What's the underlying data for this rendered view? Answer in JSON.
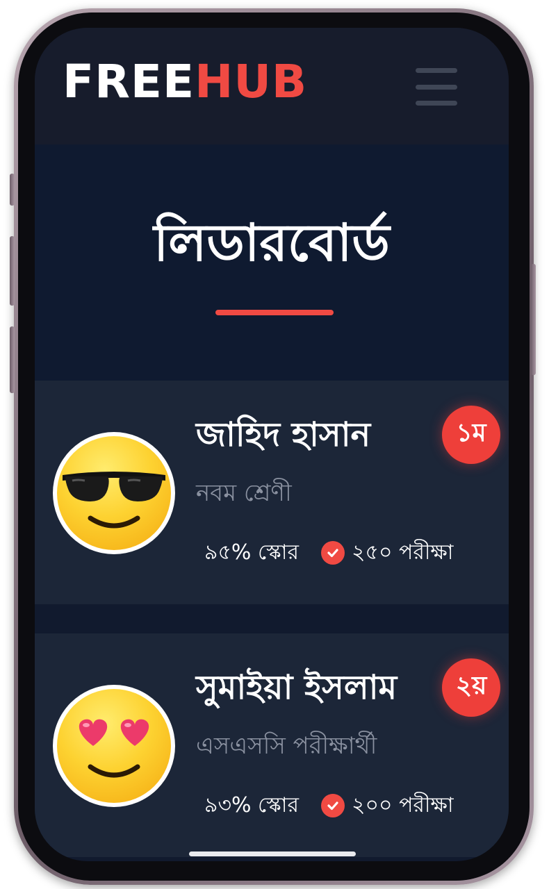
{
  "header": {
    "logo_part1": "FREE",
    "logo_part2": "HUB",
    "menu_icon": "hamburger-menu-icon"
  },
  "page": {
    "title": "লিডারবোর্ড"
  },
  "leaderboard": [
    {
      "name": "জাহিদ হাসান",
      "class": "নবম শ্রেণী",
      "score": "৯৫% স্কোর",
      "exams": "২৫০ পরীক্ষা",
      "rank": "১ম",
      "avatar": "sunglasses-emoji-icon"
    },
    {
      "name": "সুমাইয়া ইসলাম",
      "class": "এসএসসি পরীক্ষার্থী",
      "score": "৯৩% স্কোর",
      "exams": "২০০ পরীক্ষা",
      "rank": "২য়",
      "avatar": "heart-eyes-emoji-icon"
    }
  ],
  "colors": {
    "accent": "#f04a43",
    "background": "#111a2e",
    "card": "#1c2638",
    "header": "#171c2c"
  }
}
